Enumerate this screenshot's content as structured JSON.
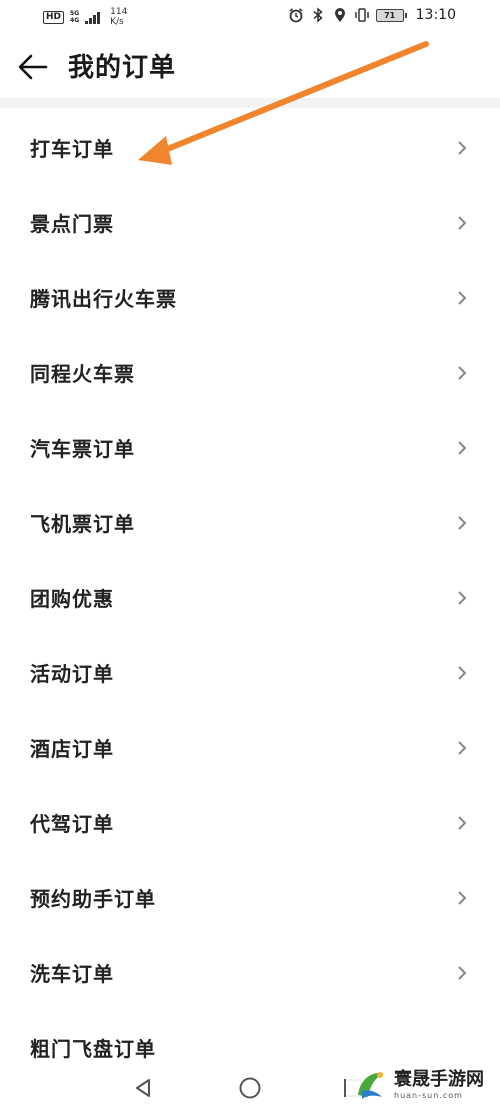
{
  "status_bar": {
    "hd": "HD",
    "net_top": "5G",
    "net_bottom": "4G",
    "speed_value": "114",
    "speed_unit": "K/s",
    "battery": "71",
    "time": "13:10"
  },
  "header": {
    "title": "我的订单"
  },
  "orders": [
    {
      "label": "打车订单"
    },
    {
      "label": "景点门票"
    },
    {
      "label": "腾讯出行火车票"
    },
    {
      "label": "同程火车票"
    },
    {
      "label": "汽车票订单"
    },
    {
      "label": "飞机票订单"
    },
    {
      "label": "团购优惠"
    },
    {
      "label": "活动订单"
    },
    {
      "label": "酒店订单"
    },
    {
      "label": "代驾订单"
    },
    {
      "label": "预约助手订单"
    },
    {
      "label": "洗车订单"
    },
    {
      "label": "粗门飞盘订单"
    }
  ],
  "annotation": {
    "color": "#f0852e"
  },
  "watermark": {
    "name": "寰晟手游网",
    "url": "huan-sun.com"
  },
  "icons": {
    "back": "arrow-left-icon",
    "chevron": "chevron-right-icon",
    "nav_back": "triangle-back-icon",
    "nav_home": "circle-home-icon",
    "nav_recent": "square-recent-icon"
  }
}
